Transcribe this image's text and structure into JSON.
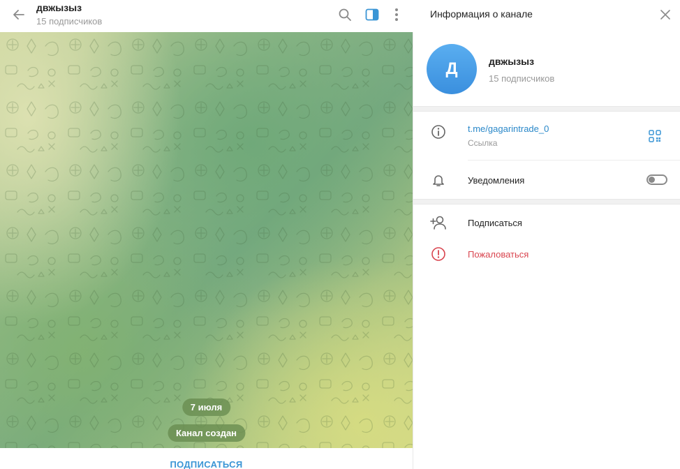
{
  "chat": {
    "title": "двжызыз",
    "subtitle": "15 подписчиков",
    "date_pill": "7 июля",
    "service_message": "Канал создан",
    "subscribe_label": "ПОДПИСАТЬСЯ"
  },
  "info_panel": {
    "title": "Информация о канале",
    "avatar_letter": "Д",
    "channel_name": "двжызыз",
    "subscribers": "15 подписчиков",
    "link": "t.me/gagarintrade_0",
    "link_caption": "Ссылка",
    "notifications_label": "Уведомления",
    "notifications_enabled": false,
    "subscribe_action": "Подписаться",
    "report_action": "Пожаловаться"
  },
  "colors": {
    "accent": "#3a95d5",
    "link": "#2a88c9",
    "danger": "#d9454f",
    "avatar": "#4a9de6"
  },
  "icons": {
    "back": "arrow-left-icon",
    "search": "search-icon",
    "panel": "sidebar-toggle-icon",
    "more": "more-vertical-icon",
    "close": "close-icon",
    "info": "info-icon",
    "qr": "qr-code-icon",
    "bell": "bell-icon",
    "add_user": "add-user-icon",
    "report": "alert-icon"
  }
}
